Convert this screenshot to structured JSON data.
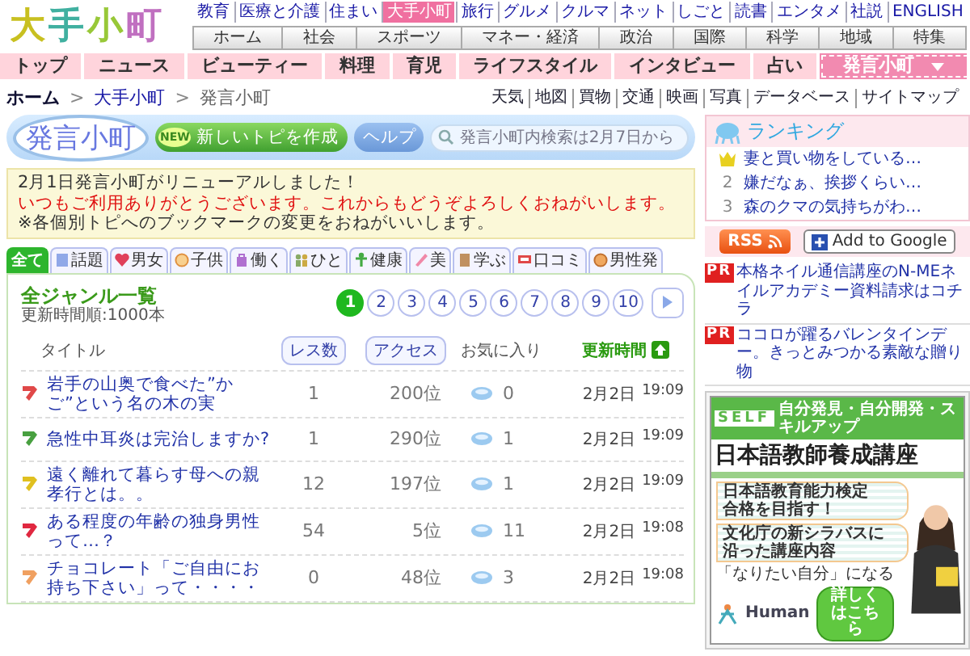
{
  "logo": {
    "text": "大手小町"
  },
  "top_links": [
    {
      "label": "教育",
      "selected": false
    },
    {
      "label": "医療と介護",
      "selected": false
    },
    {
      "label": "住まい",
      "selected": false
    },
    {
      "label": "大手小町",
      "selected": true
    },
    {
      "label": "旅行",
      "selected": false
    },
    {
      "label": "グルメ",
      "selected": false
    },
    {
      "label": "クルマ",
      "selected": false
    },
    {
      "label": "ネット",
      "selected": false
    },
    {
      "label": "しごと",
      "selected": false
    },
    {
      "label": "読書",
      "selected": false
    },
    {
      "label": "エンタメ",
      "selected": false
    },
    {
      "label": "社説",
      "selected": false
    },
    {
      "label": "ENGLISH",
      "selected": false
    }
  ],
  "section_tabs": [
    "ホーム",
    "社会",
    "スポーツ",
    "マネー・経済",
    "政治",
    "国際",
    "科学",
    "地域",
    "特集"
  ],
  "main_nav": [
    {
      "label": "トップ",
      "selected": false,
      "has_menu": false
    },
    {
      "label": "ニュース",
      "selected": false,
      "has_menu": false
    },
    {
      "label": "ビューティー",
      "selected": false,
      "has_menu": false
    },
    {
      "label": "料理",
      "selected": false,
      "has_menu": false
    },
    {
      "label": "育児",
      "selected": false,
      "has_menu": false
    },
    {
      "label": "ライフスタイル",
      "selected": false,
      "has_menu": false
    },
    {
      "label": "インタビュー",
      "selected": false,
      "has_menu": false
    },
    {
      "label": "占い",
      "selected": false,
      "has_menu": false
    },
    {
      "label": "発言小町",
      "selected": true,
      "has_menu": true
    }
  ],
  "breadcrumb": {
    "separator": ">",
    "items": [
      {
        "label": "ホーム",
        "current": false
      },
      {
        "label": "大手小町",
        "current": false
      },
      {
        "label": "発言小町",
        "current": true
      }
    ]
  },
  "utility_links": [
    "天気",
    "地図",
    "買物",
    "交通",
    "映画",
    "写真",
    "データベース",
    "サイトマップ"
  ],
  "banner": {
    "logo": "発言小町",
    "new_badge": "NEW",
    "create_button": "新しいトピを作成",
    "help_button": "ヘルプ",
    "search": {
      "placeholder": "発言小町内検索は2月7日から"
    }
  },
  "notice": [
    {
      "kind": "normal",
      "text": "2月1日発言小町がリニューアルしました！"
    },
    {
      "kind": "alert",
      "text": "いつもご利用ありがとうございます。これからもどうぞよろしくおねがいします。"
    },
    {
      "kind": "normal",
      "text": "※各個別トピへのブックマークの変更をおねがいいします。"
    }
  ],
  "genre_tabs": [
    {
      "label": "全て",
      "selected": true
    },
    {
      "label": "話題",
      "selected": false
    },
    {
      "label": "男女",
      "selected": false
    },
    {
      "label": "子供",
      "selected": false
    },
    {
      "label": "働く",
      "selected": false
    },
    {
      "label": "ひと",
      "selected": false
    },
    {
      "label": "健康",
      "selected": false
    },
    {
      "label": "美",
      "selected": false
    },
    {
      "label": "学ぶ",
      "selected": false
    },
    {
      "label": "口コミ",
      "selected": false
    },
    {
      "label": "男性発",
      "selected": false
    }
  ],
  "list": {
    "title": "全ジャンル一覧",
    "subtitle": "更新時間順:1000本",
    "pages": [
      {
        "label": "1",
        "selected": true
      },
      {
        "label": "2",
        "selected": false
      },
      {
        "label": "3",
        "selected": false
      },
      {
        "label": "4",
        "selected": false
      },
      {
        "label": "5",
        "selected": false
      },
      {
        "label": "6",
        "selected": false
      },
      {
        "label": "7",
        "selected": false
      },
      {
        "label": "8",
        "selected": false
      },
      {
        "label": "9",
        "selected": false
      },
      {
        "label": "10",
        "selected": false
      }
    ],
    "columns": [
      {
        "label": "タイトル",
        "kind": "plain"
      },
      {
        "label": "レス数",
        "kind": "button"
      },
      {
        "label": "アクセス",
        "kind": "button"
      },
      {
        "label": "お気に入り",
        "kind": "plain"
      },
      {
        "label": "更新時間",
        "kind": "sorted"
      }
    ],
    "rows": [
      {
        "title": "岩手の山奥で食べた”かご”という名の木の実",
        "responses": "1",
        "access": "200位",
        "favorites": "0",
        "date": "2月2日",
        "time": "19:09",
        "color": "#e04848"
      },
      {
        "title": "急性中耳炎は完治しますか?",
        "responses": "1",
        "access": "290位",
        "favorites": "1",
        "date": "2月2日",
        "time": "19:09",
        "color": "#48a040"
      },
      {
        "title": "遠く離れて暮らす母への親孝行とは。。",
        "responses": "12",
        "access": "197位",
        "favorites": "1",
        "date": "2月2日",
        "time": "19:09",
        "color": "#e0c020"
      },
      {
        "title": "ある程度の年齢の独身男性って…？",
        "responses": "54",
        "access": "5位",
        "favorites": "11",
        "date": "2月2日",
        "time": "19:08",
        "color": "#e02840"
      },
      {
        "title": "チョコレート「ご自由にお持ち下さい」って・・・・",
        "responses": "0",
        "access": "48位",
        "favorites": "3",
        "date": "2月2日",
        "time": "19:08",
        "color": "#f0a060"
      }
    ]
  },
  "ranking": {
    "title": "ランキング",
    "items": [
      {
        "kind": "crown",
        "text": "妻と買い物をしている…"
      },
      {
        "kind": "number",
        "rank": "2",
        "text": "嫌だなぁ、挨拶くらい…"
      },
      {
        "kind": "number",
        "rank": "3",
        "text": "森のクマの気持ちがわ…"
      }
    ]
  },
  "feeds": {
    "rss": "RSS",
    "google": "Add to Google"
  },
  "pr_links": [
    {
      "badge": "PR",
      "text": "本格ネイル通信講座のN-MEネイルアカデミー資料請求はコチラ"
    },
    {
      "badge": "PR",
      "text": "ココロが躍るバレンタインデー。きっとみつかる素敵な贈り物"
    }
  ],
  "ad": {
    "brand": "SELF",
    "tagline": "自分発見・自分開発・スキルアップ",
    "headline": "日本語教師養成講座",
    "points": [
      {
        "lines": [
          "日本語教育能力検定",
          "合格を目指す！"
        ]
      },
      {
        "lines": [
          "文化庁の新シラバスに",
          "沿った講座内容"
        ]
      }
    ],
    "slogan": "「なりたい自分」になる",
    "company": "Human",
    "cta": "詳しくはこちら"
  }
}
